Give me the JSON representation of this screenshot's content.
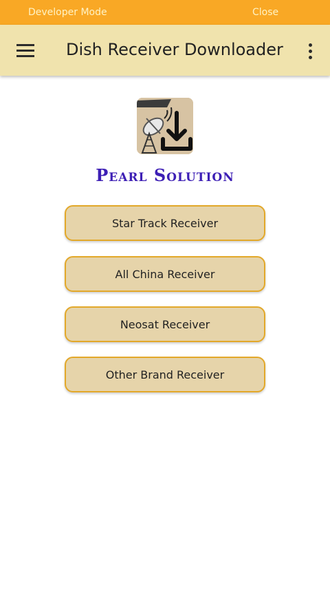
{
  "status_bar": {
    "left_label": "Developer Mode",
    "right_label": "Close"
  },
  "app_bar": {
    "menu_icon": "hamburger-menu-icon",
    "title": "Dish Receiver Downloader",
    "more_icon": "more-vertical-icon"
  },
  "logo": {
    "icon": "satellite-dish-download-icon"
  },
  "brand": {
    "name": "Pearl Solution",
    "color": "#3d1fb5"
  },
  "buttons": [
    {
      "label": "Star Track Receiver"
    },
    {
      "label": "All China Receiver"
    },
    {
      "label": "Neosat Receiver"
    },
    {
      "label": "Other Brand Receiver"
    }
  ],
  "colors": {
    "status_bar": "#f9a825",
    "app_bar": "#f0e3ad",
    "button_fill": "#e6d4aa",
    "button_border": "#e3a829"
  }
}
